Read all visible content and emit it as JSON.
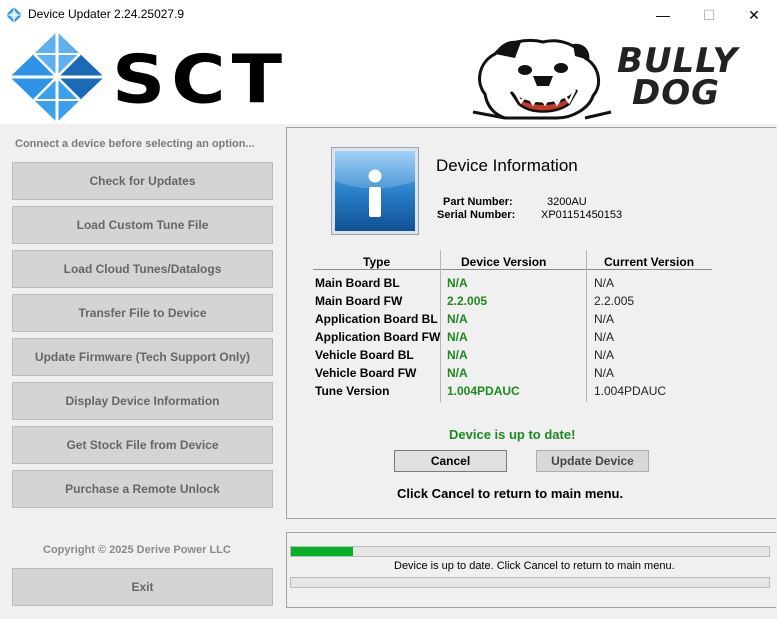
{
  "window": {
    "title": "Device Updater 2.24.25027.9",
    "minimize_glyph": "—",
    "maximize_glyph": "☐",
    "close_glyph": "✕"
  },
  "header": {
    "logo_text": "SCT",
    "brand_line1": "BULLY",
    "brand_line2": "DOG"
  },
  "sidebar": {
    "message": "Connect a device before selecting an option...",
    "buttons": [
      "Check for Updates",
      "Load Custom Tune File",
      "Load Cloud Tunes/Datalogs",
      "Transfer File to Device",
      "Update Firmware (Tech Support Only)",
      "Display Device Information",
      "Get Stock File from Device",
      "Purchase a Remote Unlock"
    ],
    "copyright": "Copyright © 2025 Derive Power LLC",
    "exit_label": "Exit"
  },
  "device_info": {
    "title": "Device Information",
    "part_number_label": "Part Number:",
    "part_number": "3200AU",
    "serial_number_label": "Serial Number:",
    "serial_number": "XP01151450153",
    "columns": [
      "Type",
      "Device Version",
      "Current Version"
    ],
    "rows": [
      {
        "type": "Main Board BL",
        "device": "N/A",
        "current": "N/A"
      },
      {
        "type": "Main Board FW",
        "device": "2.2.005",
        "current": "2.2.005"
      },
      {
        "type": "Application Board BL",
        "device": "N/A",
        "current": "N/A"
      },
      {
        "type": "Application Board FW",
        "device": "N/A",
        "current": "N/A"
      },
      {
        "type": "Vehicle Board BL",
        "device": "N/A",
        "current": "N/A"
      },
      {
        "type": "Vehicle Board FW",
        "device": "N/A",
        "current": "N/A"
      },
      {
        "type": "Tune Version",
        "device": "1.004PDAUC",
        "current": "1.004PDAUC"
      }
    ],
    "status": "Device is up to date!",
    "cancel_label": "Cancel",
    "update_label": "Update Device",
    "return_message": "Click Cancel to return to main menu."
  },
  "progress": {
    "bar1_fraction": 0.13,
    "status_text": "Device is up to date. Click Cancel to return to main menu.",
    "bar2_fraction": 0.0
  },
  "colors": {
    "accent_green": "#1d8a1d",
    "progress_green": "#06b025",
    "sct_blue": "#1f7fd1"
  }
}
